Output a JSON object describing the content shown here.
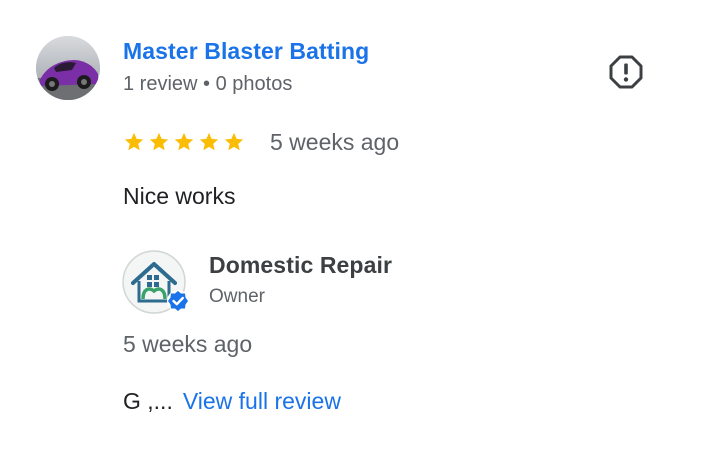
{
  "review": {
    "reviewer_name": "Master Blaster Batting",
    "reviewer_meta": "1 review • 0 photos",
    "rating": 5,
    "date": "5 weeks ago",
    "text": "Nice works",
    "avatar_icon": "car-photo-avatar",
    "flag_icon": "report-flag-icon"
  },
  "owner_reply": {
    "name": "Domestic Repair",
    "role": "Owner",
    "date": "5 weeks ago",
    "snippet": "G ,...",
    "link_label": "View full review",
    "avatar_icon": "house-logo-avatar",
    "verified_icon": "verified-badge-icon"
  },
  "colors": {
    "link": "#1a73e8",
    "star": "#fbbc04",
    "muted": "#5f6368",
    "verified": "#1a73e8"
  }
}
